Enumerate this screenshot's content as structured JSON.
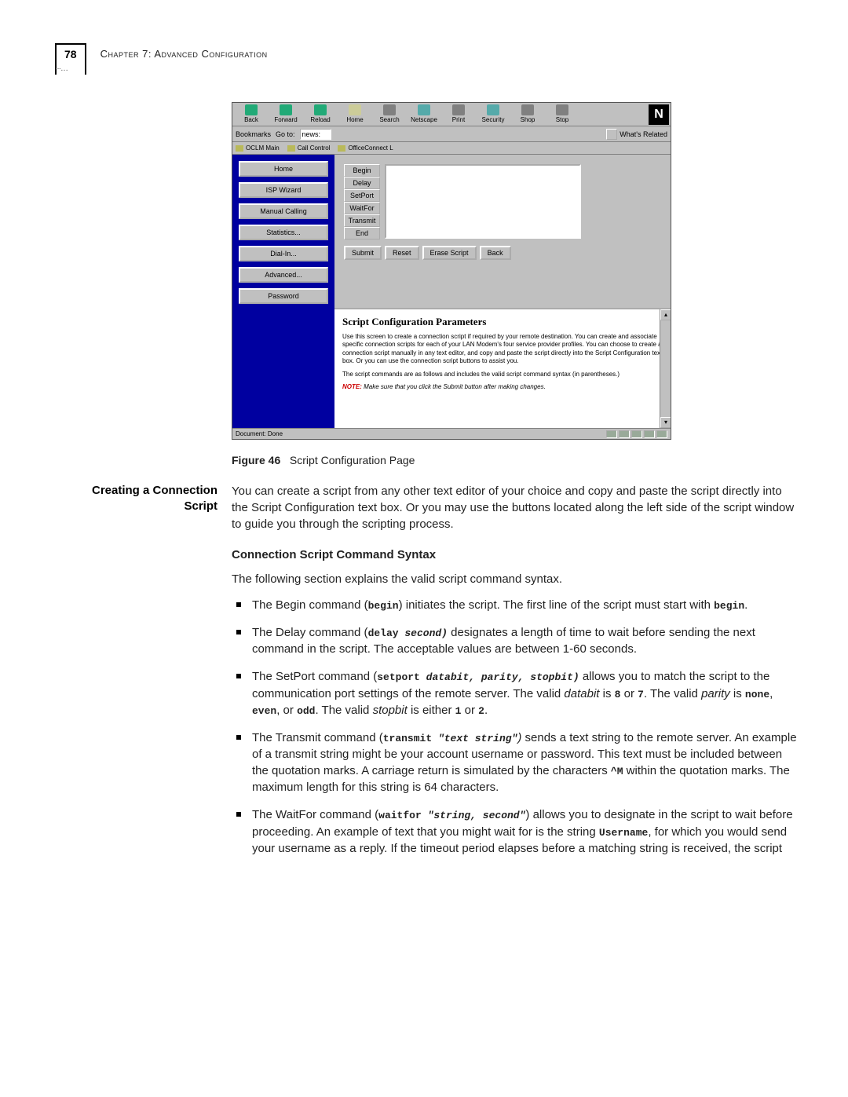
{
  "page": {
    "number": "78",
    "chapter": "Chapter 7: Advanced Configuration"
  },
  "browser": {
    "toolbar": {
      "back": "Back",
      "forward": "Forward",
      "reload": "Reload",
      "home": "Home",
      "search": "Search",
      "netscape": "Netscape",
      "print": "Print",
      "security": "Security",
      "shop": "Shop",
      "stop": "Stop"
    },
    "bookmarks_label": "Bookmarks",
    "goto_label": "Go to:",
    "goto_value": "news:",
    "related_label": "What's Related",
    "bookmark_items": [
      "OCLM Main",
      "Call Control",
      "OfficeConnect L"
    ],
    "status": "Document: Done"
  },
  "ns_logo": "N",
  "sidebar": {
    "items": [
      "Home",
      "ISP Wizard",
      "Manual Calling",
      "Statistics...",
      "Dial-In...",
      "Advanced...",
      "Password"
    ]
  },
  "script_panel": {
    "cmd_buttons": [
      "Begin",
      "Delay",
      "SetPort",
      "WaitFor",
      "Transmit",
      "End"
    ],
    "actions": {
      "submit": "Submit",
      "reset": "Reset",
      "erase": "Erase Script",
      "back": "Back"
    }
  },
  "help": {
    "title": "Script Configuration Parameters",
    "p1": "Use this screen to create a connection script if required by your remote destination. You can create and associate specific connection scripts for each of your LAN Modem's four service provider profiles.  You can choose to create a connection script manually in any text editor, and copy and paste the script directly into the Script Configuration text box.  Or you can use the connection script buttons to assist you.",
    "p2": "The script commands are as follows and includes the valid script command syntax (in parentheses.)",
    "note_label": "NOTE:",
    "note_body": "Make sure that you click the Submit button after making changes."
  },
  "figure": {
    "label": "Figure 46",
    "caption": "Script Configuration Page"
  },
  "doc": {
    "heading1": "Creating a Connection Script",
    "intro": "You can create a script from any other text editor of your choice and copy and paste the script directly into the Script Configuration text box. Or you may use the buttons located along the left side of the script window to guide you through the scripting process.",
    "heading2": "Connection Script Command Syntax",
    "lead": "The following section explains the valid script command syntax.",
    "items": {
      "begin": {
        "pre": "The Begin command (",
        "code": "begin",
        "post": ") initiates the script. The first line of the script must start with ",
        "code2": "begin",
        "tail": "."
      },
      "delay": {
        "pre": "The Delay command (",
        "code": "delay ",
        "arg": "second)",
        "post": "  designates a length of time to wait before sending the next command in the script. The acceptable values are between 1-60 seconds."
      },
      "setport": {
        "pre": "The SetPort command (",
        "code": "setport ",
        "arg": "databit, parity, stopbit)",
        "post": "  allows you to match the script to the communication port settings of the remote server. The valid ",
        "i1": "databit",
        "mid1": " is ",
        "v1": "8",
        "or1": " or ",
        "v2": "7",
        "mid2": ". The valid ",
        "i2": "parity",
        "mid3": " is ",
        "v3": "none",
        "c1": ", ",
        "v4": "even",
        "c2": ", or ",
        "v5": "odd",
        "mid4": ". The valid ",
        "i3": "stopbit",
        "mid5": " is either ",
        "v6": "1",
        "or2": " or ",
        "v7": "2",
        "tail": "."
      },
      "transmit": {
        "pre": "The Transmit command (",
        "code": "transmit ",
        "arg": "\"text string\"",
        "close": ")",
        "post": " sends a text string to the remote server. An example of a transmit string might be your account username or password. This text must be included between the quotation marks. A carriage return is simulated by the characters ",
        "cm": "^M",
        "post2": " within the quotation marks.  The maximum length for this string is 64 characters."
      },
      "waitfor": {
        "pre": "The WaitFor command (",
        "code": "waitfor ",
        "arg": "\"string, second\"",
        "post": ") allows you to designate in the script to wait before proceeding. An example of text that you might wait for is the string ",
        "u": "Username",
        "post2": ", for which you would send your username as a reply. If the timeout period elapses before a matching string is received, the script"
      }
    }
  }
}
